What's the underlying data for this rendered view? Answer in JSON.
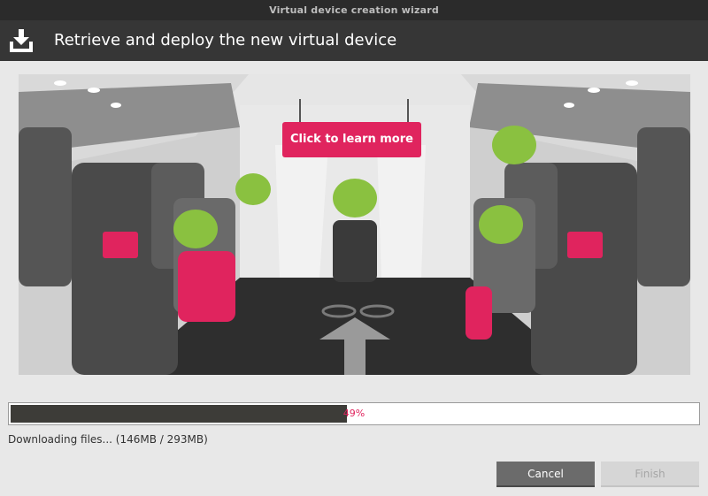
{
  "window": {
    "title": "Virtual device creation wizard"
  },
  "header": {
    "title": "Retrieve and deploy the new virtual device",
    "icon": "download-icon"
  },
  "banner": {
    "sign_text": "Click to learn more",
    "accent": "#e0245e"
  },
  "progress": {
    "value": 0.49,
    "label": "49%"
  },
  "status": {
    "text": "Downloading files... (146MB / 293MB)"
  },
  "buttons": {
    "cancel": "Cancel",
    "finish": "Finish"
  }
}
